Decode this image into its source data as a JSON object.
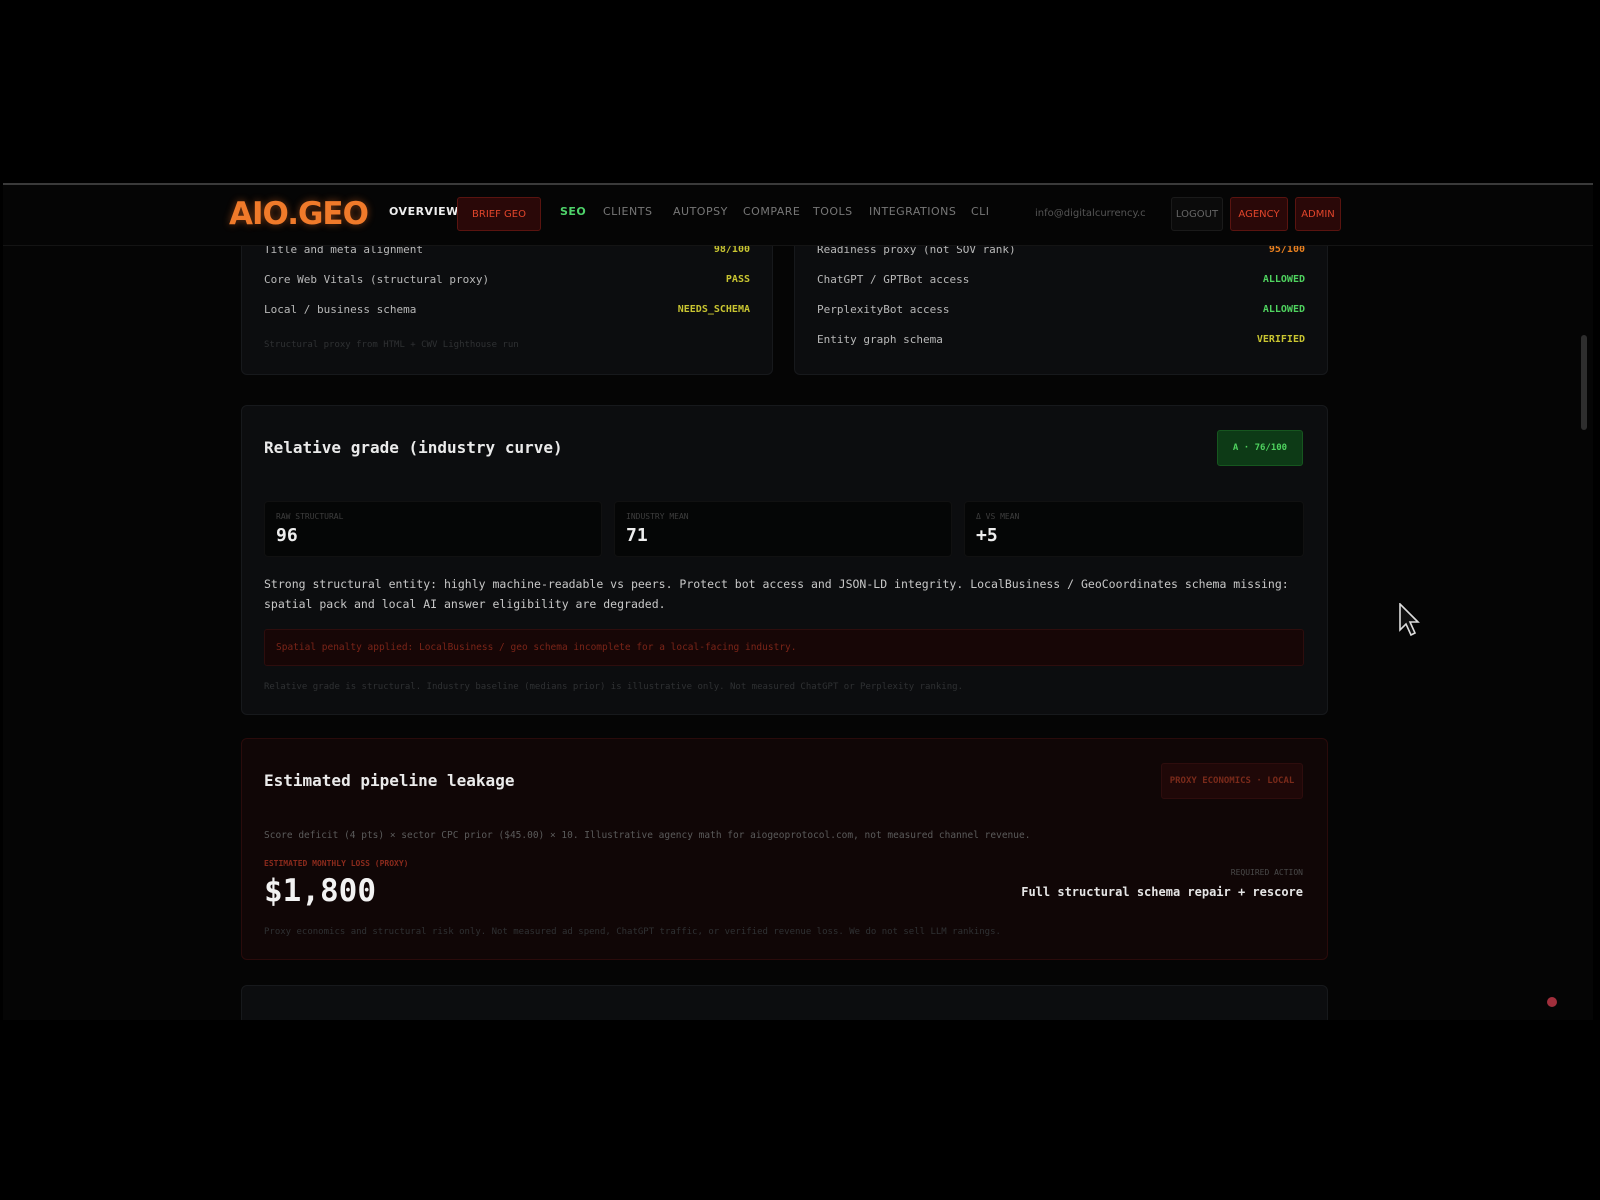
{
  "nav": {
    "logo": "AIO.GEO",
    "items": [
      {
        "label": "OVERVIEW"
      },
      {
        "label": "BRIEF GEO"
      },
      {
        "label": "SEO"
      },
      {
        "label": "CLIENTS"
      },
      {
        "label": "AUTOPSY"
      },
      {
        "label": "COMPARE"
      },
      {
        "label": "TOOLS"
      },
      {
        "label": "INTEGRATIONS"
      },
      {
        "label": "CLI"
      }
    ],
    "email": "info@digitalcurrency.c",
    "logout": "LOGOUT",
    "agency": "AGENCY",
    "admin": "ADMIN"
  },
  "left_card": {
    "rows": [
      {
        "label": "Title and meta alignment",
        "value": "98/100"
      },
      {
        "label": "Core Web Vitals (structural proxy)",
        "value": "PASS"
      },
      {
        "label": "Local / business schema",
        "value": "NEEDS_SCHEMA"
      }
    ],
    "footnote": "Structural proxy from HTML + CWV Lighthouse run"
  },
  "right_card": {
    "rows": [
      {
        "label": "Readiness proxy (not SOV rank)",
        "value": "95/100"
      },
      {
        "label": "ChatGPT / GPTBot access",
        "value": "ALLOWED"
      },
      {
        "label": "PerplexityBot access",
        "value": "ALLOWED"
      },
      {
        "label": "Entity graph schema",
        "value": "VERIFIED"
      }
    ]
  },
  "grade": {
    "title": "Relative grade (industry curve)",
    "badge": "A · 76/100",
    "stats": [
      {
        "label": "RAW STRUCTURAL",
        "value": "96"
      },
      {
        "label": "INDUSTRY MEAN",
        "value": "71"
      },
      {
        "label": "Δ VS MEAN",
        "value": "+5"
      }
    ],
    "description": "Strong structural entity: highly machine-readable vs peers. Protect bot access and JSON-LD integrity. LocalBusiness / GeoCoordinates schema missing: spatial pack and local AI answer eligibility are degraded.",
    "warning": "Spatial penalty applied: LocalBusiness / geo schema incomplete for a local-facing industry.",
    "footnote": "Relative grade is structural. Industry baseline (medians prior) is illustrative only. Not measured ChatGPT or Perplexity ranking."
  },
  "leakage": {
    "title": "Estimated pipeline leakage",
    "badge": "PROXY ECONOMICS · LOCAL",
    "formula": "Score deficit (4 pts) × sector CPC prior ($45.00) × 10. Illustrative agency math for aiogeoprotocol.com, not measured channel revenue.",
    "loss_label": "ESTIMATED MONTHLY LOSS (PROXY)",
    "amount": "$1,800",
    "action_label": "REQUIRED ACTION",
    "action": "Full structural schema repair + rescore",
    "footnote": "Proxy economics and structural risk only. Not measured ad spend, ChatGPT traffic, or verified revenue loss. We do not sell LLM rankings."
  },
  "colors": {
    "accent_orange": "#f07a2a",
    "ok_green": "#4fd35f",
    "warn_yellow": "#c9c531",
    "alert_red": "#e2452b"
  }
}
